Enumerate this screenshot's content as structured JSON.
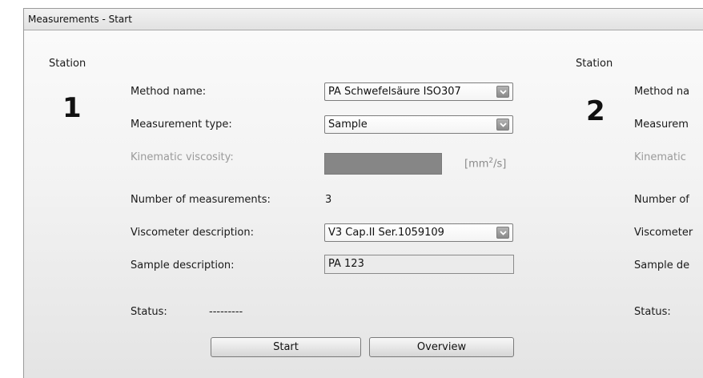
{
  "window": {
    "title": "Measurements - Start"
  },
  "station1": {
    "station_label": "Station",
    "number": "1",
    "method_name_label": "Method name:",
    "method_name_value": "PA Schwefelsäure ISO307",
    "measurement_type_label": "Measurement type:",
    "measurement_type_value": "Sample",
    "kinematic_viscosity_label": "Kinematic viscosity:",
    "kinematic_viscosity_unit_pre": "[mm",
    "kinematic_viscosity_unit_sup": "2",
    "kinematic_viscosity_unit_post": "/s]",
    "num_measurements_label": "Number of measurements:",
    "num_measurements_value": "3",
    "viscometer_label": "Viscometer description:",
    "viscometer_value": "V3 Cap.II Ser.1059109",
    "sample_label": "Sample description:",
    "sample_value": "PA 123",
    "status_label": "Status:",
    "status_value": "---------",
    "start_button": "Start",
    "overview_button": "Overview"
  },
  "station2": {
    "station_label": "Station",
    "number": "2",
    "method_name_label": "Method na",
    "measurement_type_label": "Measurem",
    "kinematic_viscosity_label": "Kinematic",
    "num_measurements_label": "Number of",
    "viscometer_label": "Viscometer",
    "sample_label": "Sample de",
    "status_label": "Status:"
  },
  "icons": {
    "dropdown": "chevron-down-icon"
  },
  "colors": {
    "accent_combo_arrow": "#9a9a9a",
    "disabled_text": "#9a9a9a",
    "viscosity_box": "#868686"
  }
}
